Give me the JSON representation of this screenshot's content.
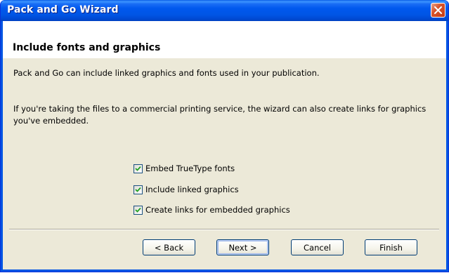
{
  "window": {
    "title": "Pack and Go Wizard",
    "close_icon": "close-icon"
  },
  "header": {
    "title": "Include fonts and graphics"
  },
  "body": {
    "para1": "Pack and Go can include linked graphics and fonts used in your publication.",
    "para2": "If you're taking the files to a commercial printing service, the wizard can also create links for graphics you've embedded."
  },
  "options": [
    {
      "label": "Embed TrueType fonts",
      "checked": true
    },
    {
      "label": "Include linked graphics",
      "checked": true
    },
    {
      "label": "Create links for embedded graphics",
      "checked": true
    }
  ],
  "buttons": {
    "back": "< Back",
    "next": "Next >",
    "cancel": "Cancel",
    "finish": "Finish"
  },
  "colors": {
    "titlebar": "#0054e3",
    "client_bg": "#ece9d8",
    "checkmark": "#21a121",
    "close_button": "#d8542c"
  }
}
